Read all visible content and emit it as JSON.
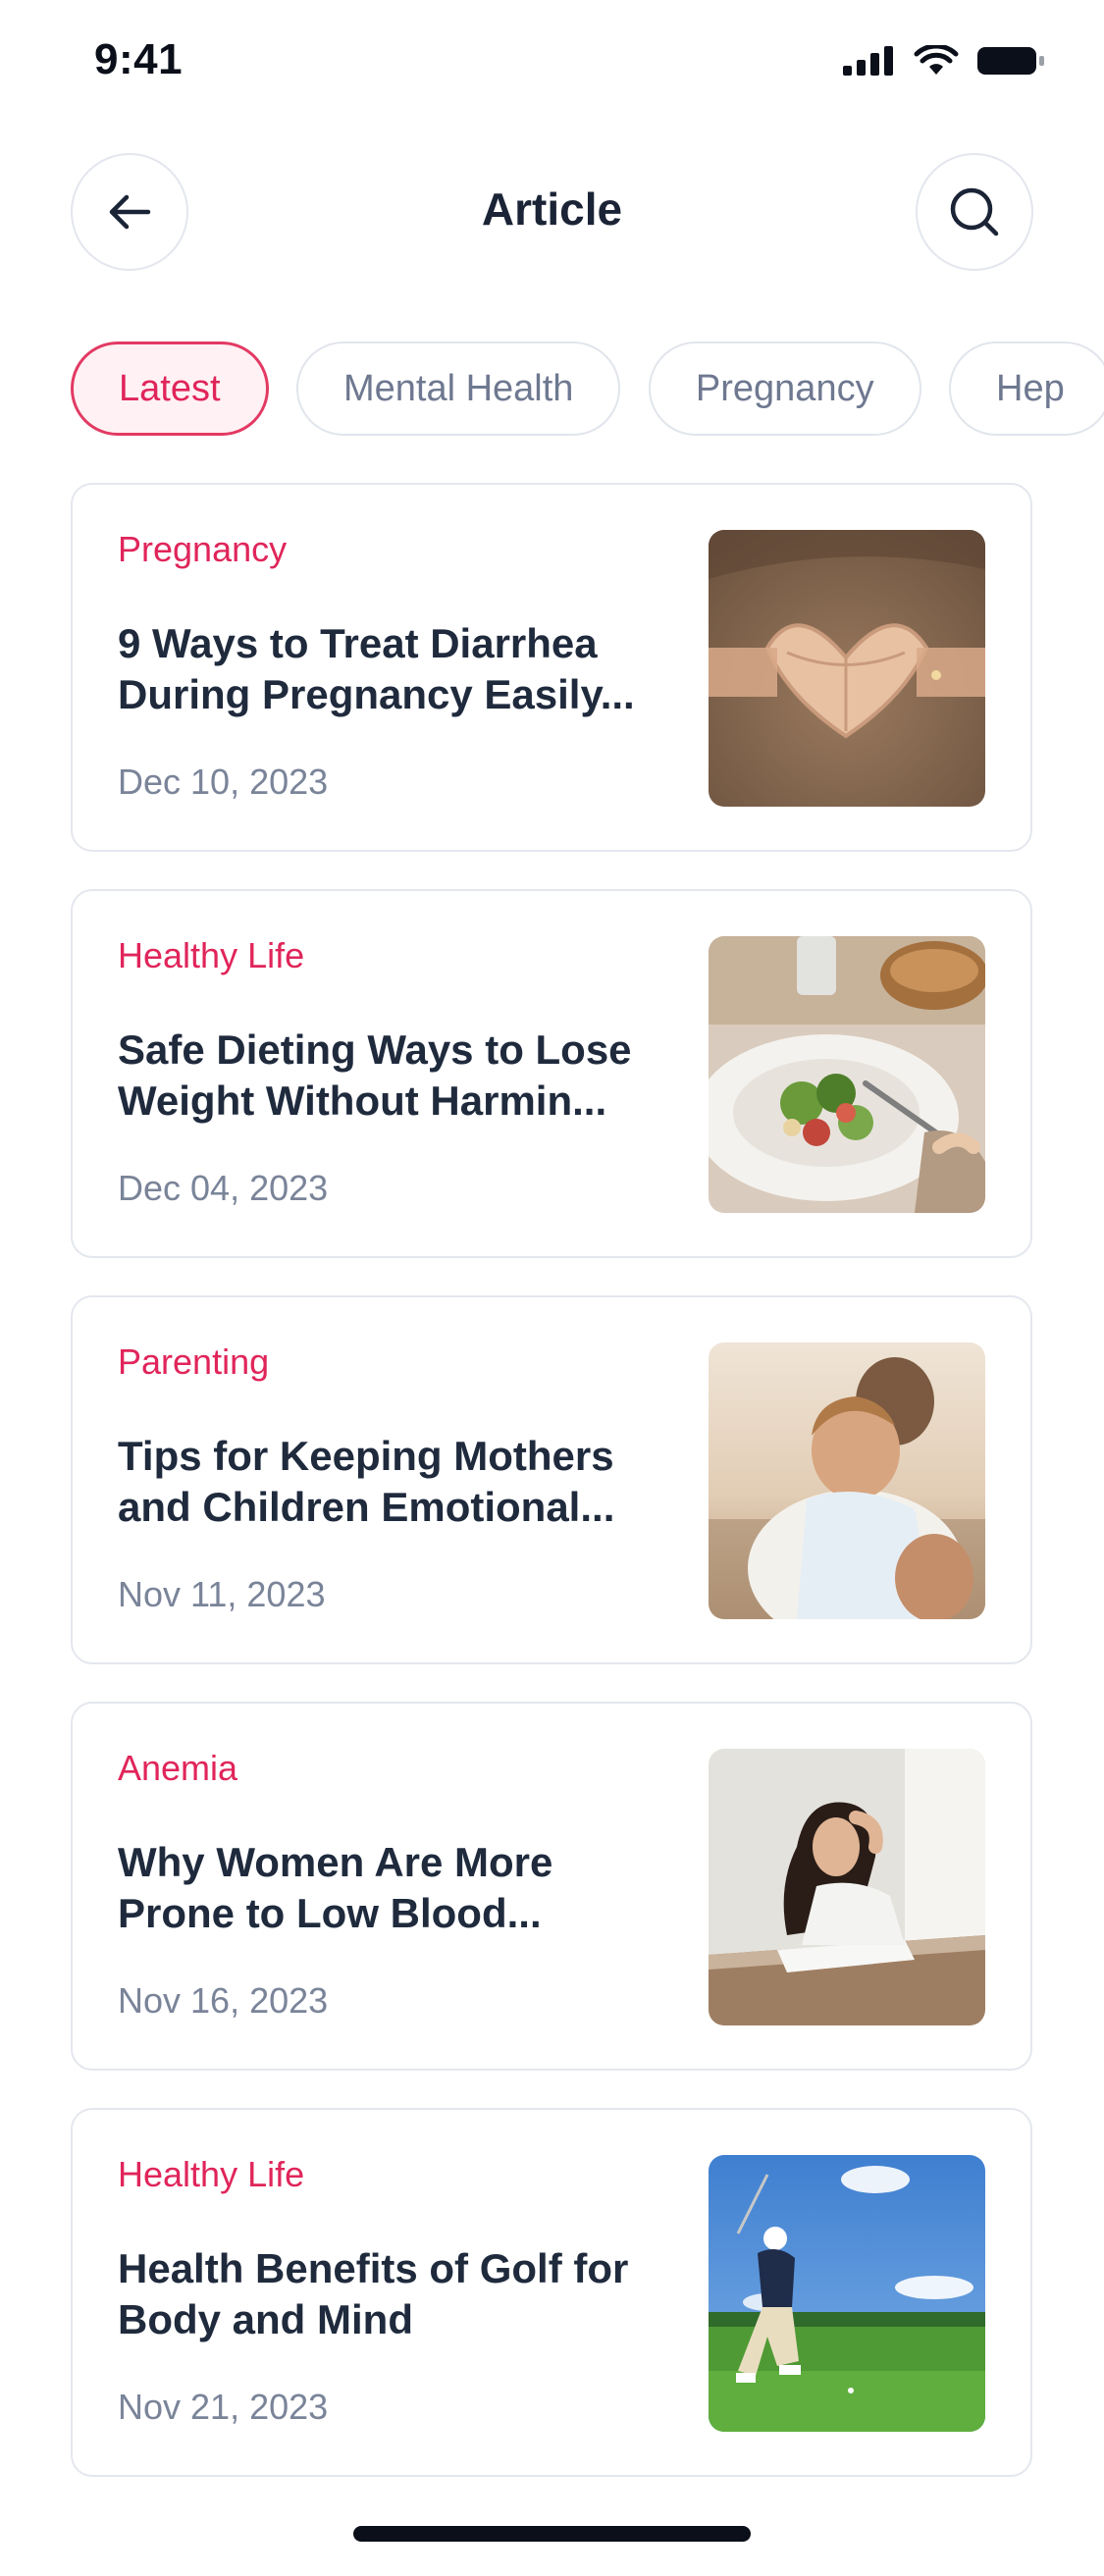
{
  "status_bar": {
    "time": "9:41"
  },
  "header": {
    "title": "Article",
    "back_icon": "arrow-left-icon",
    "search_icon": "search-icon"
  },
  "filters": {
    "chips": [
      {
        "label": "Latest",
        "active": true
      },
      {
        "label": "Mental Health",
        "active": false
      },
      {
        "label": "Pregnancy",
        "active": false
      },
      {
        "label": "Hep",
        "active": false
      }
    ]
  },
  "articles": [
    {
      "category": "Pregnancy",
      "title": "9 Ways to Treat Diarrhea During Pregnancy Easily...",
      "date": "Dec 10, 2023",
      "image": "pregnant-belly-heart-hands"
    },
    {
      "category": "Healthy Life",
      "title": "Safe Dieting Ways to Lose Weight Without Harmin...",
      "date": "Dec 04, 2023",
      "image": "salad-plate"
    },
    {
      "category": "Parenting",
      "title": "Tips for Keeping Mothers and Children Emotional...",
      "date": "Nov 11, 2023",
      "image": "mother-hugging-child"
    },
    {
      "category": "Anemia",
      "title": "Why Women Are More Prone to Low Blood...",
      "date": "Nov 16, 2023",
      "image": "tired-woman-at-desk"
    },
    {
      "category": "Healthy Life",
      "title": "Health Benefits of Golf for Body and Mind",
      "date": "Nov 21, 2023",
      "image": "golfer-swinging"
    }
  ],
  "colors": {
    "accent": "#e0255a",
    "text_primary": "#1f2a3d",
    "text_secondary": "#7a8499",
    "border": "#e4e7ee"
  }
}
